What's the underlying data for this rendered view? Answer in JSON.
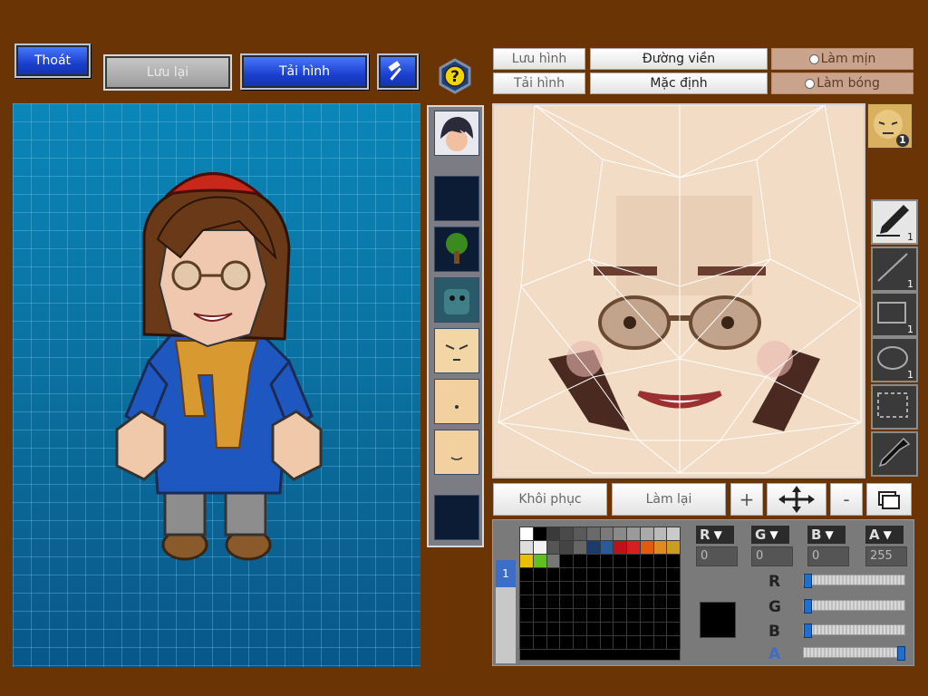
{
  "top_left": {
    "exit_label": "Thoát",
    "save_label": "Lưu lại",
    "load_label": "Tải hình"
  },
  "top_right": {
    "save_image_label": "Lưu hình",
    "load_image_label": "Tải hình",
    "outline_label": "Đường viền",
    "default_label": "Mặc định",
    "smooth_label": "Làm mịn",
    "gloss_label": "Làm bóng"
  },
  "tools": {
    "face_badge": "1",
    "pen_count": "1",
    "line_count": "1",
    "rect_count": "1",
    "ellipse_count": "1"
  },
  "bottom_buttons": {
    "restore_label": "Khôi phục",
    "redo_label": "Làm lại",
    "zoom_in_label": "+",
    "zoom_out_label": "-"
  },
  "palette": {
    "tab_label": "1",
    "colors": [
      "#ffffff",
      "#000000",
      "#3a3a3a",
      "#4a4a4a",
      "#5a5a5a",
      "#6a6a6a",
      "#7a7a7a",
      "#8a8a8a",
      "#9a9a9a",
      "#aaaaaa",
      "#bababa",
      "#cacaca",
      "#dddddd",
      "#f2f2f2",
      "#555555",
      "#444444",
      "#666666",
      "#1b3b6b",
      "#2a5a9a",
      "#c0101a",
      "#d42020",
      "#e05a10",
      "#e08a20",
      "#c8a020",
      "#e8c000",
      "#60c020",
      "#777777"
    ],
    "current_color": "#000000"
  },
  "rgba": {
    "r_label": "R",
    "g_label": "G",
    "b_label": "B",
    "a_label": "A",
    "r_value": "0",
    "g_value": "0",
    "b_value": "0",
    "a_value": "255",
    "r_level": 0,
    "g_level": 0,
    "b_level": 0,
    "a_level": 1
  }
}
